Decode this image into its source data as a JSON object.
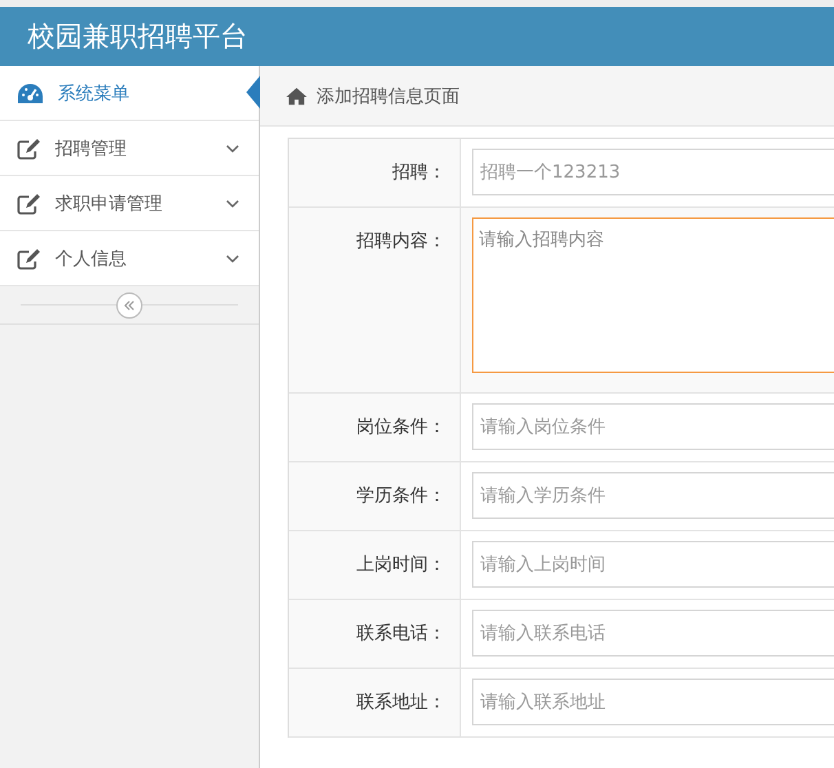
{
  "header": {
    "title": "校园兼职招聘平台"
  },
  "sidebar": {
    "items": [
      {
        "label": "系统菜单",
        "kind": "title",
        "selected": true
      },
      {
        "label": "招聘管理",
        "kind": "menu",
        "selected": false
      },
      {
        "label": "求职申请管理",
        "kind": "menu",
        "selected": false
      },
      {
        "label": "个人信息",
        "kind": "menu",
        "selected": false
      }
    ]
  },
  "breadcrumb": {
    "text": "添加招聘信息页面"
  },
  "form": {
    "fields": [
      {
        "label": "招聘：",
        "kind": "text",
        "value": "招聘一个123213"
      },
      {
        "label": "招聘内容：",
        "kind": "textarea",
        "placeholder": "请输入招聘内容",
        "focused": true
      },
      {
        "label": "岗位条件：",
        "kind": "text",
        "placeholder": "请输入岗位条件"
      },
      {
        "label": "学历条件：",
        "kind": "text",
        "placeholder": "请输入学历条件"
      },
      {
        "label": "上岗时间：",
        "kind": "text",
        "placeholder": "请输入上岗时间"
      },
      {
        "label": "联系电话：",
        "kind": "text",
        "placeholder": "请输入联系电话"
      },
      {
        "label": "联系地址：",
        "kind": "text",
        "placeholder": "请输入联系地址"
      }
    ]
  }
}
